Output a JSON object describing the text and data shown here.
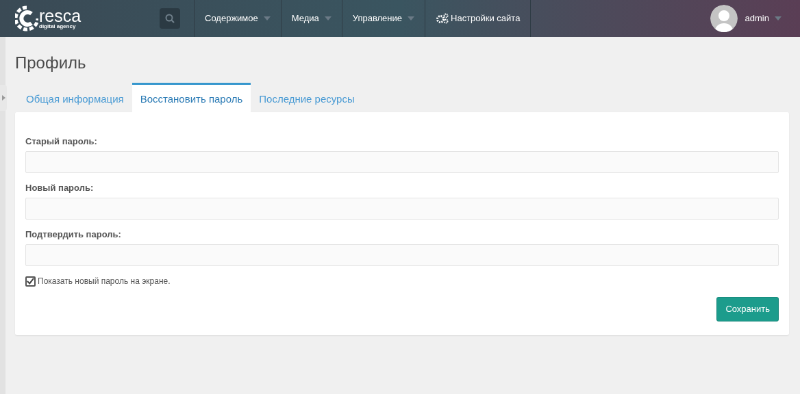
{
  "logo": {
    "name": "resca",
    "tagline": "digital agency"
  },
  "nav": [
    {
      "label": "Содержимое",
      "kind": "dropdown"
    },
    {
      "label": "Медиа",
      "kind": "dropdown"
    },
    {
      "label": "Управление",
      "kind": "dropdown"
    },
    {
      "label": "Настройки сайта",
      "kind": "settings"
    }
  ],
  "user": {
    "name": "admin"
  },
  "page_title": "Профиль",
  "tabs": [
    {
      "label": "Общая информация",
      "selected": false
    },
    {
      "label": "Восстановить пароль",
      "selected": true
    },
    {
      "label": "Последние ресурсы",
      "selected": false
    }
  ],
  "fields": [
    {
      "label": "Старый пароль:"
    },
    {
      "label": "Новый пароль:"
    },
    {
      "label": "Подтвердить пароль:"
    }
  ],
  "show_password": {
    "label": "Показать новый пароль на экране.",
    "checked": true
  },
  "save_button": "Сохранить"
}
